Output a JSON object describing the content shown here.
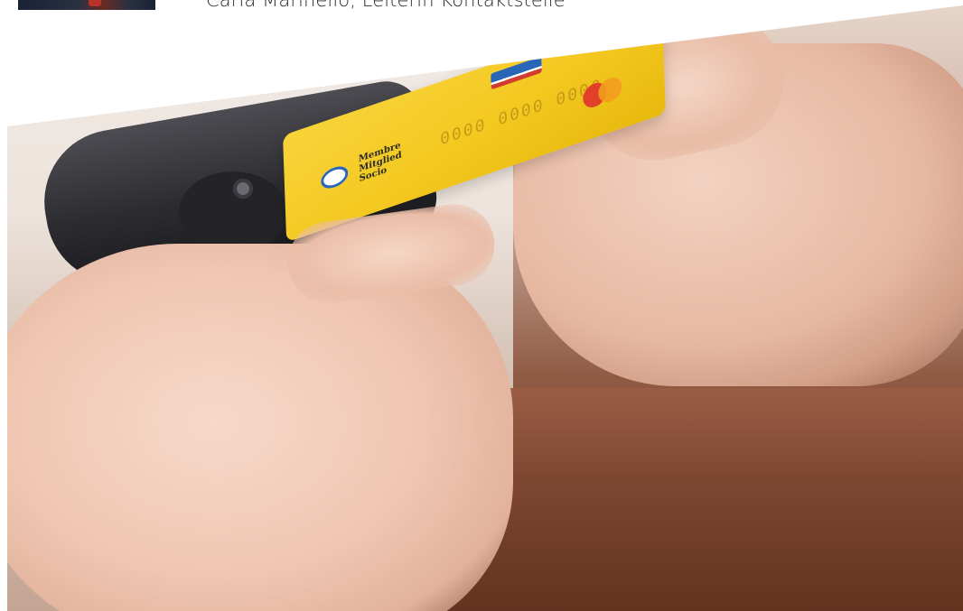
{
  "header": {
    "caption": "Carla Marinello, Leiterin Kontaktstelle"
  },
  "hero": {
    "card": {
      "logo_text": [
        "Membre",
        "Mitglied",
        "Socio"
      ],
      "number": "0000 0000 0000"
    }
  }
}
